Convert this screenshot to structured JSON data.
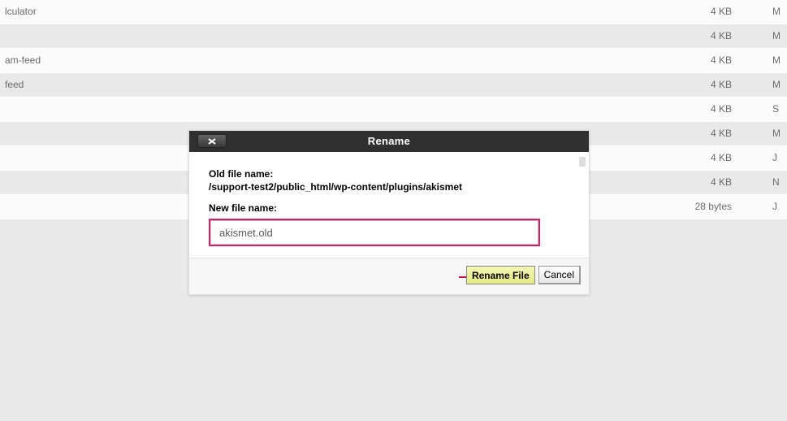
{
  "rows": [
    {
      "name": "lculator",
      "size": "4 KB",
      "date": "M"
    },
    {
      "name": "",
      "size": "4 KB",
      "date": "M"
    },
    {
      "name": "am-feed",
      "size": "4 KB",
      "date": "M"
    },
    {
      "name": "feed",
      "size": "4 KB",
      "date": "M"
    },
    {
      "name": "",
      "size": "4 KB",
      "date": "S"
    },
    {
      "name": "",
      "size": "4 KB",
      "date": "M"
    },
    {
      "name": "",
      "size": "4 KB",
      "date": "J"
    },
    {
      "name": "",
      "size": "4 KB",
      "date": "N"
    },
    {
      "name": "",
      "size": "28 bytes",
      "date": "J"
    }
  ],
  "dialog": {
    "title": "Rename",
    "old_label": "Old file name:",
    "old_value": "/support-test2/public_html/wp-content/plugins/akismet",
    "new_label": "New file name:",
    "new_value": "akismet.old",
    "rename_btn": "Rename File",
    "cancel_btn": "Cancel"
  }
}
